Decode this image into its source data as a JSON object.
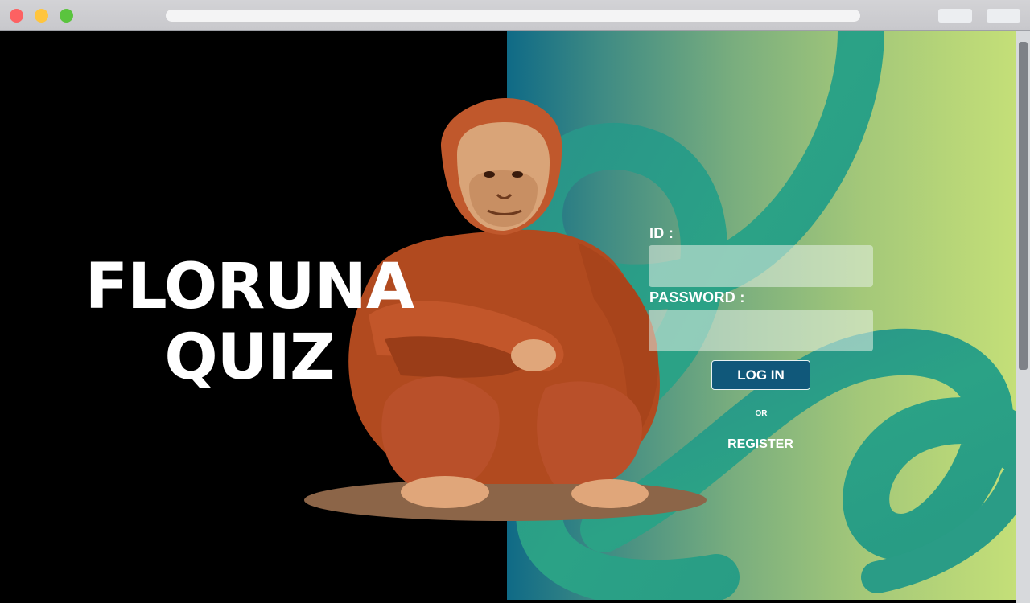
{
  "browser": {
    "window_controls": [
      "close",
      "minimize",
      "zoom"
    ]
  },
  "hero": {
    "title_line1": "FLORUNA",
    "title_line2": "QUIZ",
    "illustration": "orangutan-illustration"
  },
  "login": {
    "id_label": "ID :",
    "password_label": "PASSWORD :",
    "id_value": "",
    "password_value": "",
    "login_button": "LOG IN",
    "or_text": "OR",
    "register_link": "REGISTER"
  },
  "colors": {
    "page_background": "#000000",
    "gradient_start": "#0f6a86",
    "gradient_end": "#c4df78",
    "swirl": "#2a9d85",
    "button_fill": "#10587a",
    "text": "#ffffff"
  }
}
